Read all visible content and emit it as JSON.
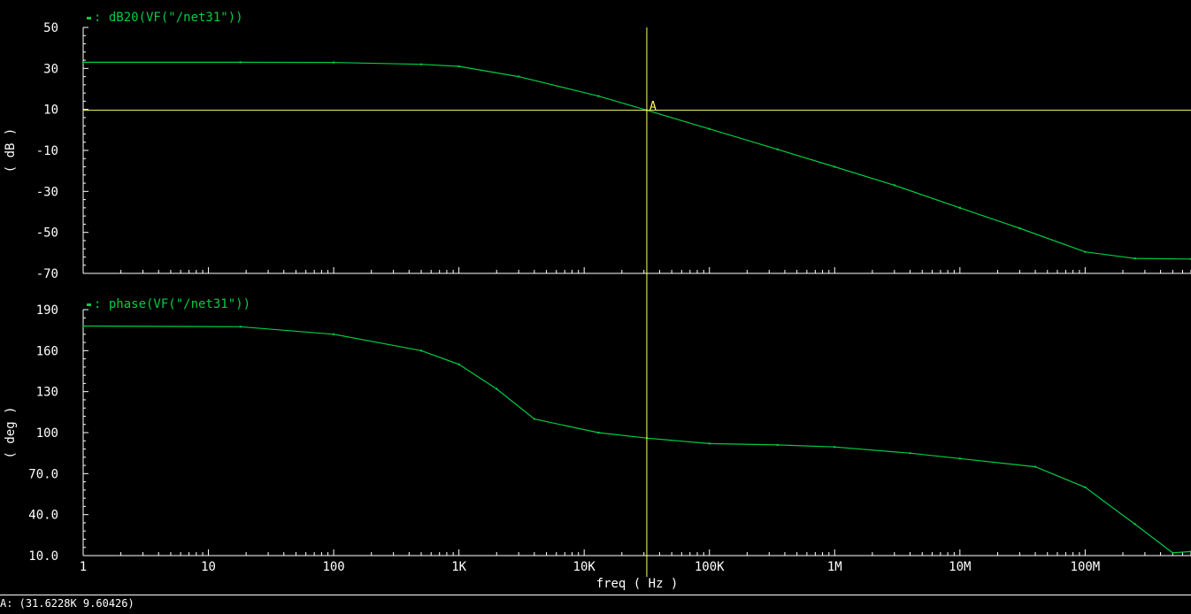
{
  "chart_data": [
    {
      "type": "line",
      "legend_label": "dB20(VF(\"/net31\"))",
      "ylabel": "( dB )",
      "yticks": [
        "50",
        "30",
        "10",
        "-10",
        "-30",
        "-50",
        "-70"
      ],
      "ylim": [
        -70,
        50
      ],
      "x_scale": "log",
      "xlim": [
        1,
        700000000
      ],
      "series": [
        {
          "color": "#00cc44",
          "x": [
            1,
            18,
            100,
            500,
            1000,
            3000,
            13000,
            31622.8,
            100000,
            350000,
            1000000,
            3000000,
            10000000,
            30000000,
            100000000,
            250000000,
            700000000
          ],
          "values": [
            33,
            33,
            32.9,
            32,
            31,
            26,
            16.5,
            9.6,
            0.5,
            -9.5,
            -18,
            -27,
            -38,
            -48,
            -59.5,
            -62.7,
            -63
          ]
        }
      ]
    },
    {
      "type": "line",
      "legend_label": "phase(VF(\"/net31\"))",
      "ylabel": "( deg )",
      "yticks": [
        "190",
        "160",
        "130",
        "100",
        "70.0",
        "40.0",
        "10.0"
      ],
      "ylim": [
        10,
        190
      ],
      "x_scale": "log",
      "xlim": [
        1,
        700000000
      ],
      "series": [
        {
          "color": "#00cc44",
          "x": [
            1,
            18,
            100,
            500,
            1000,
            2000,
            4000,
            13000,
            31622.8,
            100000,
            350000,
            1000000,
            4000000,
            10000000,
            40000000,
            100000000,
            250000000,
            500000000,
            700000000
          ],
          "values": [
            178,
            177.5,
            172,
            160,
            150,
            132,
            110,
            100,
            96,
            92,
            91,
            89.5,
            85,
            81,
            75,
            60,
            33,
            12,
            13
          ]
        }
      ]
    }
  ],
  "xaxis": {
    "label": "freq ( Hz )",
    "ticks": [
      {
        "v": 1,
        "t": "1"
      },
      {
        "v": 10,
        "t": "10"
      },
      {
        "v": 100,
        "t": "100"
      },
      {
        "v": 1000,
        "t": "1K"
      },
      {
        "v": 10000,
        "t": "10K"
      },
      {
        "v": 100000,
        "t": "100K"
      },
      {
        "v": 1000000,
        "t": "1M"
      },
      {
        "v": 10000000,
        "t": "10M"
      },
      {
        "v": 100000000,
        "t": "100M"
      }
    ]
  },
  "marker": {
    "name": "A",
    "x": 31622.8,
    "y": 9.60426
  },
  "status_text": "A: (31.6228K 9.60426)"
}
